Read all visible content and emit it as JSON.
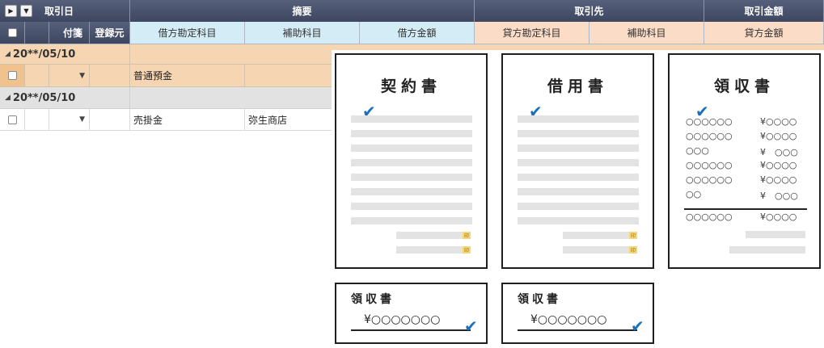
{
  "header": {
    "row1": {
      "date": "取引日",
      "summary": "摘要",
      "partner": "取引先",
      "amount": "取引金額"
    },
    "row2": {
      "tag": "付箋",
      "source": "登録元",
      "debit_account": "借方勘定科目",
      "debit_sub": "補助科目",
      "debit_amount": "借方金額",
      "credit_account": "貸方勘定科目",
      "credit_sub": "補助科目",
      "credit_amount": "貸方金額"
    },
    "expand_icon": "play-triangle-icon",
    "dropdown_icon": "chevron-down-icon"
  },
  "rows": [
    {
      "group_date": "20**/05/10",
      "debit_account": "普通預金",
      "debit_sub": ""
    },
    {
      "group_date": "20**/05/10",
      "debit_account": "売掛金",
      "debit_sub": "弥生商店"
    }
  ],
  "documents": {
    "contract": {
      "title": "契約書",
      "stamp": "印"
    },
    "loan": {
      "title": "借用書",
      "stamp": "印"
    },
    "receipt_big": {
      "title": "領収書",
      "items": [
        {
          "name": "○○○○○○",
          "price": "¥○○○○"
        },
        {
          "name": "○○○○○○",
          "price": "¥○○○○"
        },
        {
          "name": "○○○",
          "price": "¥　○○○"
        },
        {
          "name": "○○○○○○",
          "price": "¥○○○○"
        },
        {
          "name": "○○○○○○",
          "price": "¥○○○○"
        },
        {
          "name": "○○",
          "price": "¥　○○○"
        }
      ],
      "total_name": "○○○○○○",
      "total_price": "¥○○○○"
    },
    "receipt_small_1": {
      "title": "領収書",
      "amount": "¥○○○○○○○"
    },
    "receipt_small_2": {
      "title": "領収書",
      "amount": "¥○○○○○○○"
    }
  },
  "colors": {
    "header_dark": "#4a536c",
    "header_blue": "#d4ecf6",
    "header_peach": "#fbdcc6",
    "row_peach": "#f6d5b3",
    "row_gray": "#e2e2e2",
    "check_blue": "#1a6fc0"
  }
}
